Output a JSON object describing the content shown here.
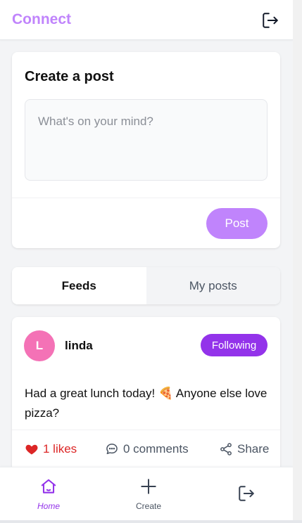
{
  "header": {
    "brand": "Connect",
    "logout_icon": "logout-icon"
  },
  "create_post": {
    "title": "Create a post",
    "placeholder": "What's on your mind?",
    "value": "",
    "post_label": "Post"
  },
  "tabs": [
    {
      "label": "Feeds",
      "active": true
    },
    {
      "label": "My posts",
      "active": false
    }
  ],
  "post": {
    "author_initial": "L",
    "author": "linda",
    "follow_label": "Following",
    "text": "Had a great lunch today! 🍕 Anyone else love pizza?",
    "likes_label": "1 likes",
    "comments_label": "0 comments",
    "share_label": "Share"
  },
  "bottom_nav": [
    {
      "label": "Home",
      "icon": "home-icon",
      "active": true
    },
    {
      "label": "Create",
      "icon": "plus-icon",
      "active": false
    },
    {
      "label": "",
      "icon": "logout-icon",
      "active": false
    }
  ],
  "colors": {
    "brand": "#c084fc",
    "accent": "#9333ea",
    "avatar": "#f472b6",
    "like": "#dc2626"
  }
}
